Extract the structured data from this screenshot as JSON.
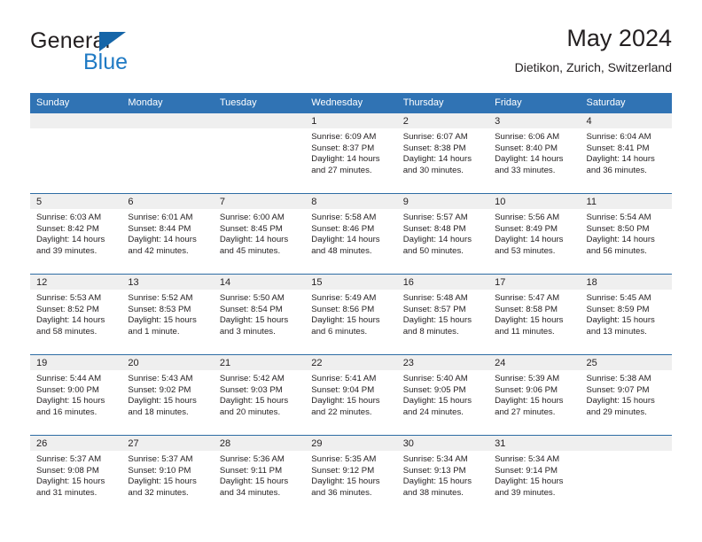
{
  "brand": {
    "name_part1": "General",
    "name_part2": "Blue",
    "triangle_icon": "triangle-logo-icon",
    "colors": {
      "dark": "#231f20",
      "blue": "#1f7ac4",
      "triangle": "#1565a8"
    }
  },
  "header": {
    "title": "May 2024",
    "location": "Dietikon, Zurich, Switzerland"
  },
  "theme": {
    "header_blue": "#3073b4",
    "row_divider_blue": "#2e6da4",
    "daynum_band": "#efefef",
    "text": "#231f20"
  },
  "weekdays": [
    "Sunday",
    "Monday",
    "Tuesday",
    "Wednesday",
    "Thursday",
    "Friday",
    "Saturday"
  ],
  "weeks": [
    [
      {
        "day": "",
        "sunrise": "",
        "sunset": "",
        "daylight1": "",
        "daylight2": "",
        "empty": true
      },
      {
        "day": "",
        "sunrise": "",
        "sunset": "",
        "daylight1": "",
        "daylight2": "",
        "empty": true
      },
      {
        "day": "",
        "sunrise": "",
        "sunset": "",
        "daylight1": "",
        "daylight2": "",
        "empty": true
      },
      {
        "day": "1",
        "sunrise": "Sunrise: 6:09 AM",
        "sunset": "Sunset: 8:37 PM",
        "daylight1": "Daylight: 14 hours",
        "daylight2": "and 27 minutes."
      },
      {
        "day": "2",
        "sunrise": "Sunrise: 6:07 AM",
        "sunset": "Sunset: 8:38 PM",
        "daylight1": "Daylight: 14 hours",
        "daylight2": "and 30 minutes."
      },
      {
        "day": "3",
        "sunrise": "Sunrise: 6:06 AM",
        "sunset": "Sunset: 8:40 PM",
        "daylight1": "Daylight: 14 hours",
        "daylight2": "and 33 minutes."
      },
      {
        "day": "4",
        "sunrise": "Sunrise: 6:04 AM",
        "sunset": "Sunset: 8:41 PM",
        "daylight1": "Daylight: 14 hours",
        "daylight2": "and 36 minutes."
      }
    ],
    [
      {
        "day": "5",
        "sunrise": "Sunrise: 6:03 AM",
        "sunset": "Sunset: 8:42 PM",
        "daylight1": "Daylight: 14 hours",
        "daylight2": "and 39 minutes."
      },
      {
        "day": "6",
        "sunrise": "Sunrise: 6:01 AM",
        "sunset": "Sunset: 8:44 PM",
        "daylight1": "Daylight: 14 hours",
        "daylight2": "and 42 minutes."
      },
      {
        "day": "7",
        "sunrise": "Sunrise: 6:00 AM",
        "sunset": "Sunset: 8:45 PM",
        "daylight1": "Daylight: 14 hours",
        "daylight2": "and 45 minutes."
      },
      {
        "day": "8",
        "sunrise": "Sunrise: 5:58 AM",
        "sunset": "Sunset: 8:46 PM",
        "daylight1": "Daylight: 14 hours",
        "daylight2": "and 48 minutes."
      },
      {
        "day": "9",
        "sunrise": "Sunrise: 5:57 AM",
        "sunset": "Sunset: 8:48 PM",
        "daylight1": "Daylight: 14 hours",
        "daylight2": "and 50 minutes."
      },
      {
        "day": "10",
        "sunrise": "Sunrise: 5:56 AM",
        "sunset": "Sunset: 8:49 PM",
        "daylight1": "Daylight: 14 hours",
        "daylight2": "and 53 minutes."
      },
      {
        "day": "11",
        "sunrise": "Sunrise: 5:54 AM",
        "sunset": "Sunset: 8:50 PM",
        "daylight1": "Daylight: 14 hours",
        "daylight2": "and 56 minutes."
      }
    ],
    [
      {
        "day": "12",
        "sunrise": "Sunrise: 5:53 AM",
        "sunset": "Sunset: 8:52 PM",
        "daylight1": "Daylight: 14 hours",
        "daylight2": "and 58 minutes."
      },
      {
        "day": "13",
        "sunrise": "Sunrise: 5:52 AM",
        "sunset": "Sunset: 8:53 PM",
        "daylight1": "Daylight: 15 hours",
        "daylight2": "and 1 minute."
      },
      {
        "day": "14",
        "sunrise": "Sunrise: 5:50 AM",
        "sunset": "Sunset: 8:54 PM",
        "daylight1": "Daylight: 15 hours",
        "daylight2": "and 3 minutes."
      },
      {
        "day": "15",
        "sunrise": "Sunrise: 5:49 AM",
        "sunset": "Sunset: 8:56 PM",
        "daylight1": "Daylight: 15 hours",
        "daylight2": "and 6 minutes."
      },
      {
        "day": "16",
        "sunrise": "Sunrise: 5:48 AM",
        "sunset": "Sunset: 8:57 PM",
        "daylight1": "Daylight: 15 hours",
        "daylight2": "and 8 minutes."
      },
      {
        "day": "17",
        "sunrise": "Sunrise: 5:47 AM",
        "sunset": "Sunset: 8:58 PM",
        "daylight1": "Daylight: 15 hours",
        "daylight2": "and 11 minutes."
      },
      {
        "day": "18",
        "sunrise": "Sunrise: 5:45 AM",
        "sunset": "Sunset: 8:59 PM",
        "daylight1": "Daylight: 15 hours",
        "daylight2": "and 13 minutes."
      }
    ],
    [
      {
        "day": "19",
        "sunrise": "Sunrise: 5:44 AM",
        "sunset": "Sunset: 9:00 PM",
        "daylight1": "Daylight: 15 hours",
        "daylight2": "and 16 minutes."
      },
      {
        "day": "20",
        "sunrise": "Sunrise: 5:43 AM",
        "sunset": "Sunset: 9:02 PM",
        "daylight1": "Daylight: 15 hours",
        "daylight2": "and 18 minutes."
      },
      {
        "day": "21",
        "sunrise": "Sunrise: 5:42 AM",
        "sunset": "Sunset: 9:03 PM",
        "daylight1": "Daylight: 15 hours",
        "daylight2": "and 20 minutes."
      },
      {
        "day": "22",
        "sunrise": "Sunrise: 5:41 AM",
        "sunset": "Sunset: 9:04 PM",
        "daylight1": "Daylight: 15 hours",
        "daylight2": "and 22 minutes."
      },
      {
        "day": "23",
        "sunrise": "Sunrise: 5:40 AM",
        "sunset": "Sunset: 9:05 PM",
        "daylight1": "Daylight: 15 hours",
        "daylight2": "and 24 minutes."
      },
      {
        "day": "24",
        "sunrise": "Sunrise: 5:39 AM",
        "sunset": "Sunset: 9:06 PM",
        "daylight1": "Daylight: 15 hours",
        "daylight2": "and 27 minutes."
      },
      {
        "day": "25",
        "sunrise": "Sunrise: 5:38 AM",
        "sunset": "Sunset: 9:07 PM",
        "daylight1": "Daylight: 15 hours",
        "daylight2": "and 29 minutes."
      }
    ],
    [
      {
        "day": "26",
        "sunrise": "Sunrise: 5:37 AM",
        "sunset": "Sunset: 9:08 PM",
        "daylight1": "Daylight: 15 hours",
        "daylight2": "and 31 minutes."
      },
      {
        "day": "27",
        "sunrise": "Sunrise: 5:37 AM",
        "sunset": "Sunset: 9:10 PM",
        "daylight1": "Daylight: 15 hours",
        "daylight2": "and 32 minutes."
      },
      {
        "day": "28",
        "sunrise": "Sunrise: 5:36 AM",
        "sunset": "Sunset: 9:11 PM",
        "daylight1": "Daylight: 15 hours",
        "daylight2": "and 34 minutes."
      },
      {
        "day": "29",
        "sunrise": "Sunrise: 5:35 AM",
        "sunset": "Sunset: 9:12 PM",
        "daylight1": "Daylight: 15 hours",
        "daylight2": "and 36 minutes."
      },
      {
        "day": "30",
        "sunrise": "Sunrise: 5:34 AM",
        "sunset": "Sunset: 9:13 PM",
        "daylight1": "Daylight: 15 hours",
        "daylight2": "and 38 minutes."
      },
      {
        "day": "31",
        "sunrise": "Sunrise: 5:34 AM",
        "sunset": "Sunset: 9:14 PM",
        "daylight1": "Daylight: 15 hours",
        "daylight2": "and 39 minutes."
      },
      {
        "day": "",
        "sunrise": "",
        "sunset": "",
        "daylight1": "",
        "daylight2": "",
        "empty": true
      }
    ]
  ]
}
